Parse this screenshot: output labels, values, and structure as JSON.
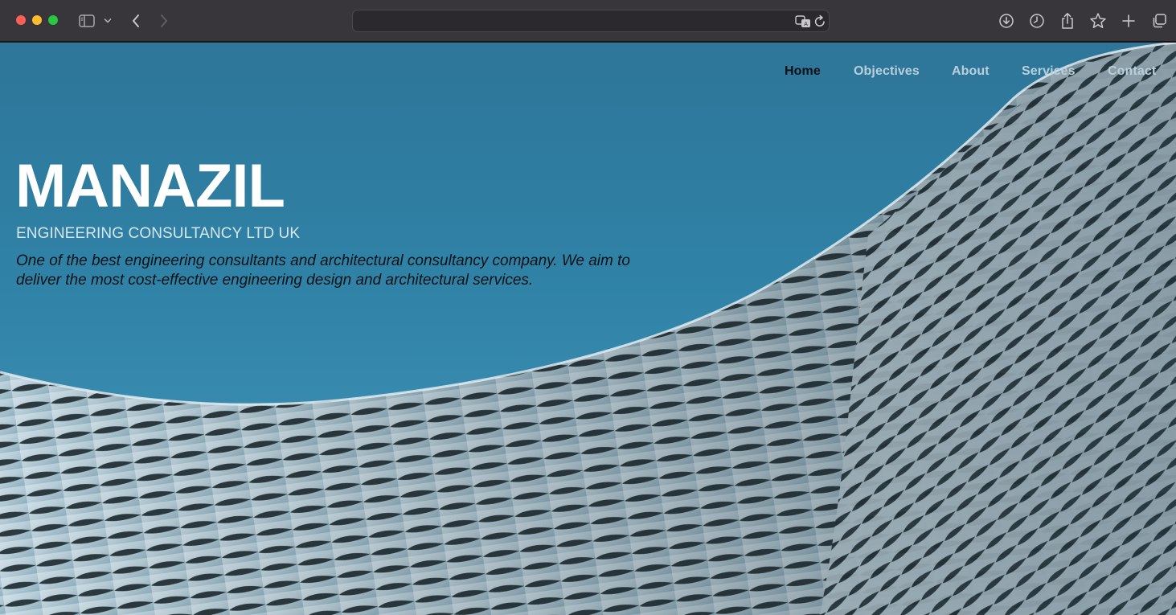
{
  "browser": {
    "url_text": "",
    "icons": [
      "sidebar-icon",
      "chevron-down-icon",
      "back-icon",
      "forward-icon",
      "translate-icon",
      "reload-icon",
      "download-icon",
      "history-icon",
      "share-icon",
      "bookmark-star-icon",
      "new-tab-icon",
      "tab-overview-icon"
    ]
  },
  "nav": {
    "items": [
      {
        "label": "Home",
        "active": true
      },
      {
        "label": "Objectives",
        "active": false
      },
      {
        "label": "About",
        "active": false
      },
      {
        "label": "Services",
        "active": false
      },
      {
        "label": "Contact",
        "active": false
      }
    ]
  },
  "hero": {
    "brand": "MANAZIL",
    "tagline": "ENGINEERING CONSULTANCY LTD UK",
    "description": "One of the best engineering consultants and architectural consultancy company. We aim to deliver the most cost-effective engineering design and architectural services."
  },
  "colors": {
    "sky": "#2f82a6",
    "facade": "#c9dbe4",
    "nav_active": "#0b1014",
    "nav_inactive": "#b9cfdb",
    "brand": "#ffffff"
  }
}
